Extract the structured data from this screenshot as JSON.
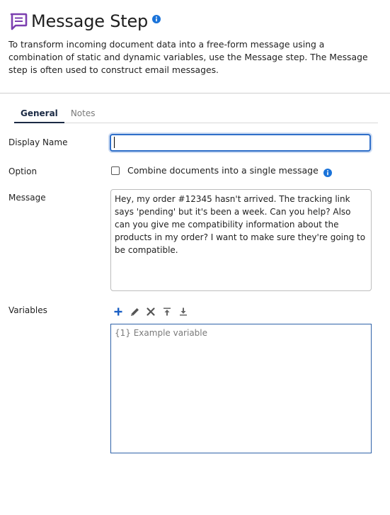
{
  "header": {
    "title": "Message Step",
    "description": "To transform incoming document data into a free-form message using a combination of static and dynamic variables, use the Message step. The Message step is often used to construct email messages."
  },
  "tabs": [
    {
      "label": "General",
      "active": true
    },
    {
      "label": "Notes",
      "active": false
    }
  ],
  "form": {
    "display_name_label": "Display Name",
    "display_name_value": "",
    "option_label": "Option",
    "option_checkbox_label": "Combine documents into a single message",
    "option_checked": false,
    "message_label": "Message",
    "message_value": "Hey, my order #12345 hasn't arrived. The tracking link says 'pending' but it's been a week. Can you help? Also can you give me compatibility information about the products in my order? I want to make sure they're going to be compatible.",
    "variables_label": "Variables",
    "variables_items": [
      "{1} Example variable"
    ]
  },
  "toolbar": {
    "icons": [
      "add-icon",
      "edit-icon",
      "delete-icon",
      "move-top-icon",
      "move-bottom-icon"
    ]
  },
  "colors": {
    "brand_purple": "#7c3fb0",
    "info_blue": "#1a73d9",
    "focus_blue": "#2f6fc9",
    "tab_active": "#1b2a44"
  }
}
